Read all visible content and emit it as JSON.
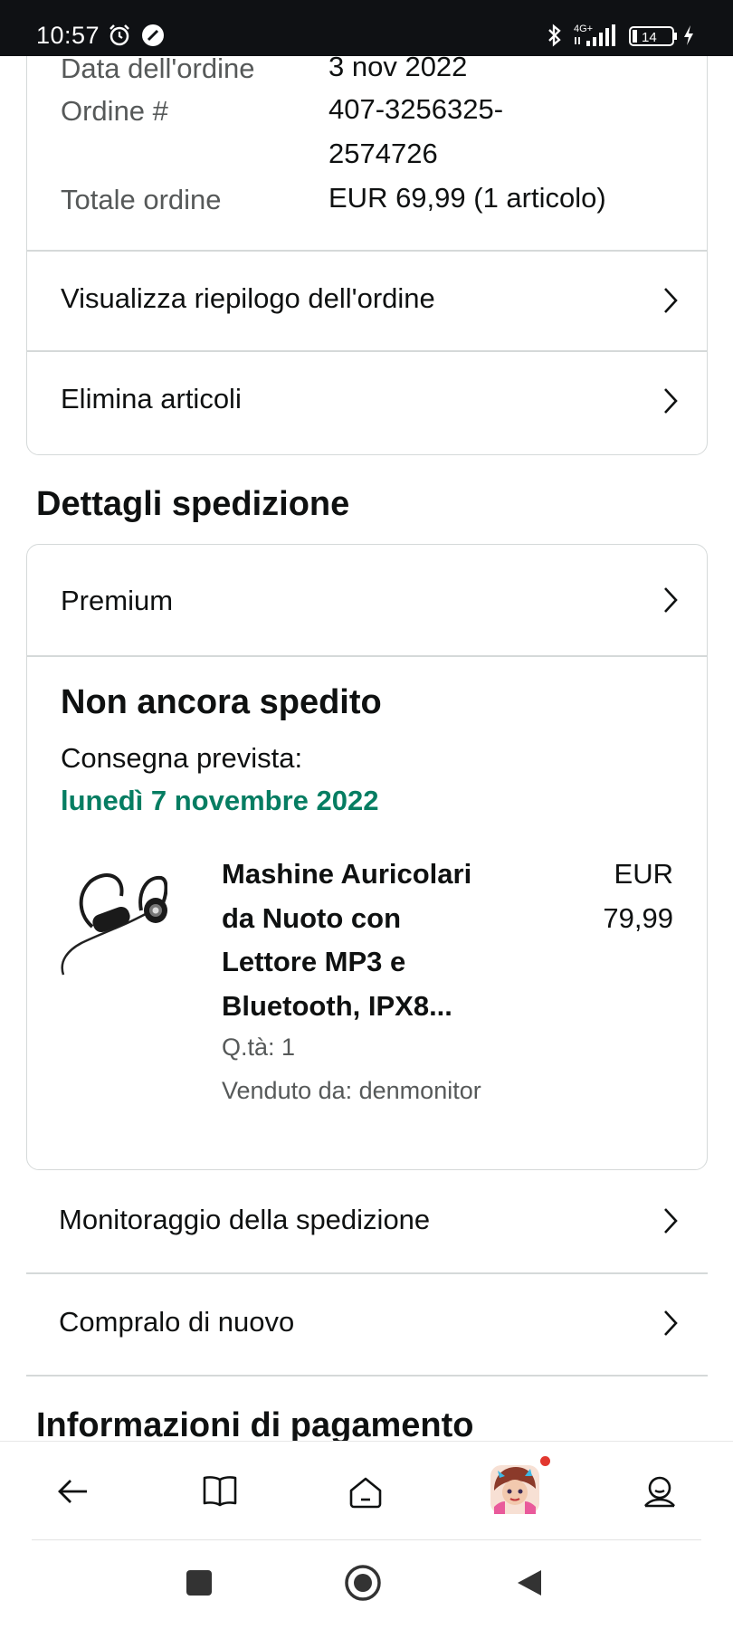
{
  "status_bar": {
    "time": "10:57",
    "network": "4G+",
    "battery": "14"
  },
  "order_info": {
    "date_label": "Data dell'ordine",
    "date_value": "3 nov 2022",
    "number_label": "Ordine #",
    "number_line1": "407-3256325-",
    "number_line2": "2574726",
    "total_label": "Totale ordine",
    "total_value": "EUR 69,99 (1 articolo)"
  },
  "order_actions": [
    {
      "label": "Visualizza riepilogo dell'ordine"
    },
    {
      "label": "Elimina articoli"
    }
  ],
  "shipping": {
    "section_title": "Dettagli spedizione",
    "service": "Premium",
    "status": "Non ancora spedito",
    "delivery_label": "Consegna prevista:",
    "delivery_date": "lunedì 7 novembre 2022",
    "delivery_date_color": "#067d62",
    "product": {
      "title_lines": [
        "Mashine Auricolari",
        "da Nuoto con",
        "Lettore MP3 e",
        "Bluetooth, IPX8..."
      ],
      "price_lines": [
        "EUR",
        "79,99"
      ],
      "quantity": "Q.tà: 1",
      "seller": "Venduto da: denmonitor",
      "image": "earphones-image"
    }
  },
  "shipping_actions": [
    {
      "label": "Monitoraggio della spedizione"
    },
    {
      "label": "Compralo di nuovo"
    }
  ],
  "payment": {
    "section_title": "Informazioni di pagamento"
  },
  "app_nav": {
    "items": [
      "back-icon",
      "book-icon",
      "home-icon",
      "avatar",
      "account-icon"
    ],
    "notification_dot_color": "#e2372f"
  },
  "system_nav": [
    "recents-icon",
    "home-circle-icon",
    "back-triangle-icon"
  ]
}
